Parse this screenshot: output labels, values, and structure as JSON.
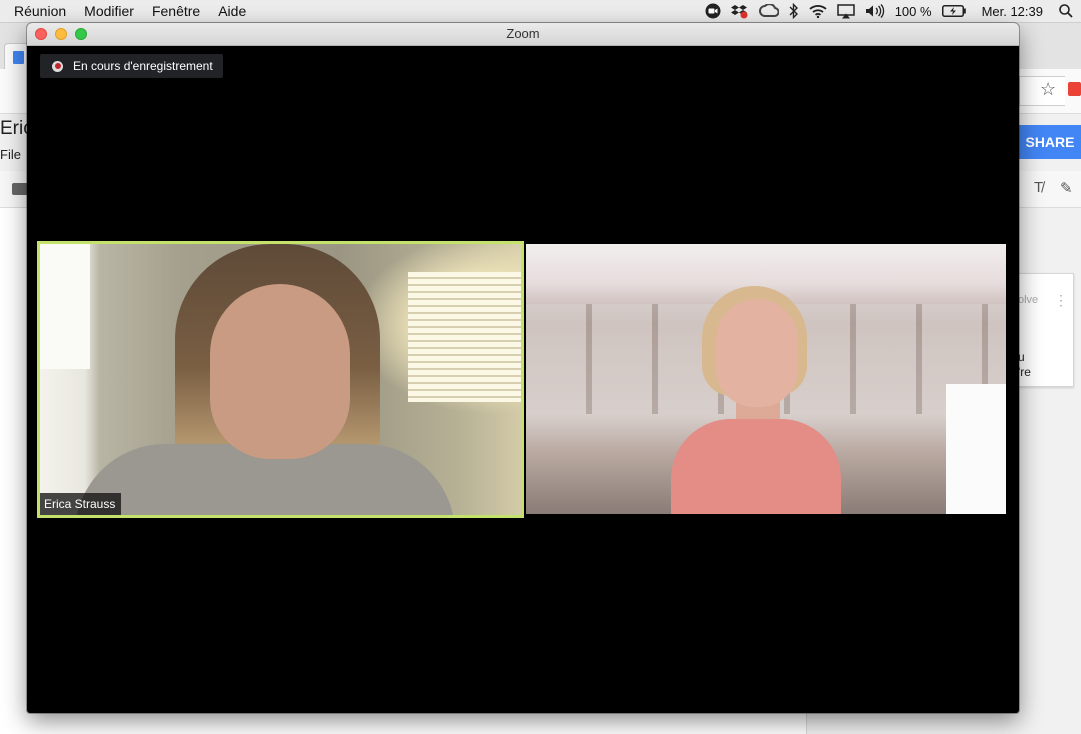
{
  "menubar": {
    "menus": [
      "Réunion",
      "Modifier",
      "Fenêtre",
      "Aide"
    ],
    "battery_text": "100 %",
    "clock": "Mer. 12:39",
    "tray_icons": [
      "zoom-video-icon",
      "dropbox-icon",
      "creative-cloud-icon",
      "bluetooth-icon",
      "wifi-icon",
      "airplay-icon",
      "volume-icon",
      "battery-icon",
      "spotlight-search-icon"
    ]
  },
  "background_app": {
    "doc_title_partial": "Eric",
    "file_menu_partial": "File",
    "share_label": "SHARE",
    "comment": {
      "resolve_partial": "olve",
      "line1_partial": "u",
      "line2_partial": "'re"
    }
  },
  "zoom": {
    "window_title": "Zoom",
    "recording_label": "En cours d'enregistrement",
    "participants": [
      {
        "name": "Erica Strauss",
        "active_speaker": true,
        "highlight_color": "#c4e26b"
      },
      {
        "name": "",
        "active_speaker": false
      }
    ]
  }
}
